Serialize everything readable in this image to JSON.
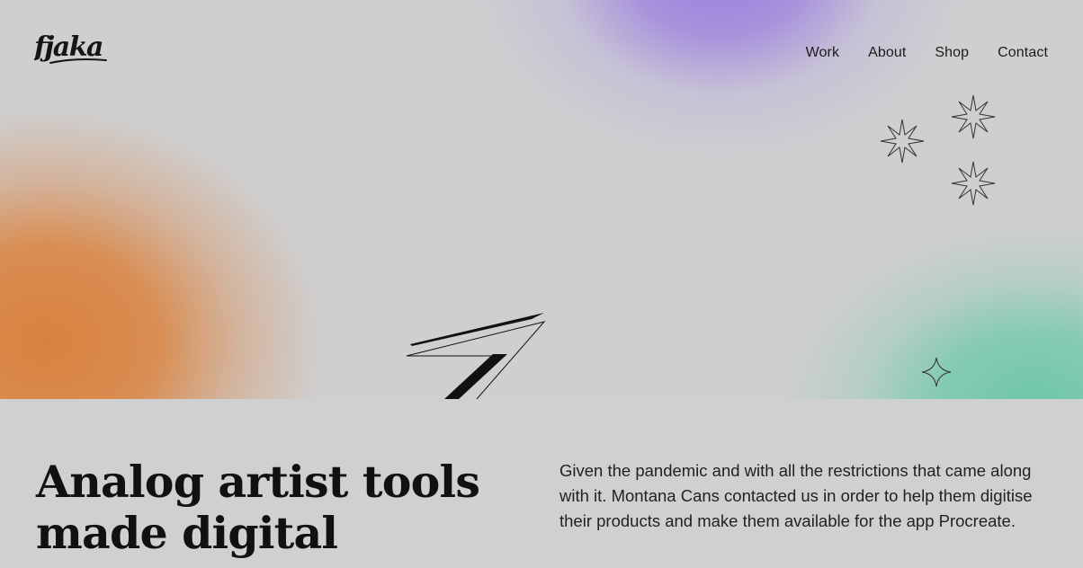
{
  "brand": {
    "logo_text": "fjaka"
  },
  "nav": {
    "items": [
      {
        "label": "Work"
      },
      {
        "label": "About"
      },
      {
        "label": "Shop"
      },
      {
        "label": "Contact"
      }
    ]
  },
  "hero": {
    "gradient_colors": {
      "orange": "#d9823f",
      "purple": "#9a7de0",
      "green": "#6fc6a8",
      "background": "#cfcfd0"
    },
    "icons": [
      "sparkle-icon",
      "sparkle-icon",
      "sparkle-icon",
      "small-sparkle-icon",
      "arrow-icon"
    ]
  },
  "main": {
    "headline": "Analog artist tools made digital",
    "description": "Given the pandemic and with all the restrictions that came along with it. Montana Cans contacted us in order to help them digitise their products and make them available for the app Procreate."
  }
}
